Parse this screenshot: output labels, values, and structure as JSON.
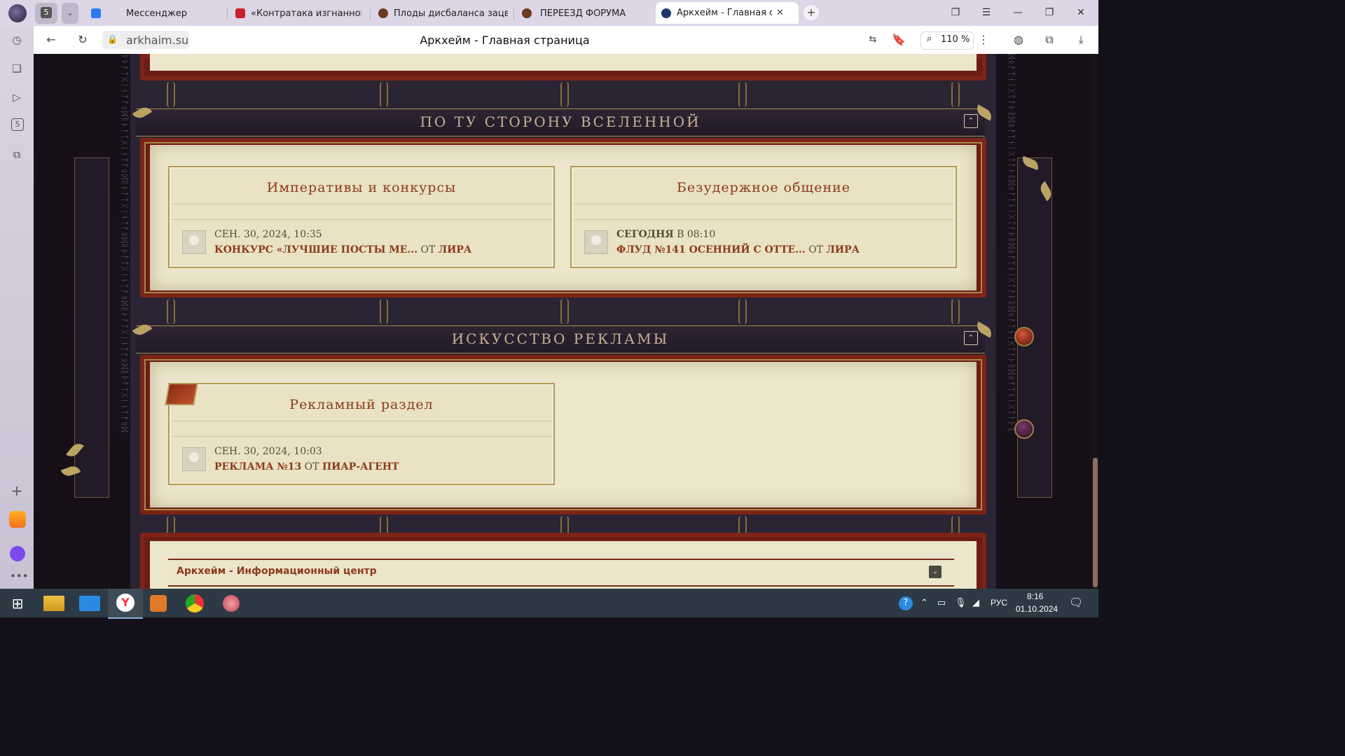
{
  "browser": {
    "tab_count": "5",
    "tabs": [
      {
        "label": "Мессенджер",
        "color": "#2a7cf6"
      },
      {
        "label": "«Контратака изгнанного",
        "color": "#c8202a"
      },
      {
        "label": "Плоды дисбаланса зацве",
        "color": "#6b3a22"
      },
      {
        "label": "ПЕРЕЕЗД ФОРУМА",
        "color": "#6b3a22"
      },
      {
        "label": "Аркхейм - Главная стр",
        "color": "#1f3a6a"
      }
    ],
    "url": "arkhaim.su",
    "page_title": "Аркхейм - Главная страница",
    "zoom": "110 %",
    "sidebar_badge": "5"
  },
  "forum": {
    "categories": [
      {
        "title": "ПО ТУ СТОРОНУ ВСЕЛЕННОЙ",
        "forums": [
          {
            "title": "Императивы и конкурсы",
            "date": "СЕН. 30, 2024, 10:35",
            "topic": "КОНКУРС «ЛУЧШИЕ ПОСТЫ МЕ...",
            "by": "ОТ",
            "author": "ЛИРА"
          },
          {
            "title": "Безудержное общение",
            "date_bold": "СЕГОДНЯ",
            "date": "В 08:10",
            "topic": "ФЛУД №141 ОСЕННИЙ С ОТТЕ...",
            "by": "ОТ",
            "author": "ЛИРА"
          }
        ]
      },
      {
        "title": "ИСКУССТВО РЕКЛАМЫ",
        "forums": [
          {
            "title": "Рекламный раздел",
            "date": "СЕН. 30, 2024, 10:03",
            "topic": "РЕКЛАМА №13",
            "by": "ОТ",
            "author": "ПИАР-АГЕНТ"
          }
        ]
      }
    ],
    "info_center": "Аркхейм - Информационный центр"
  },
  "taskbar": {
    "lang": "РУС",
    "time": "8:16",
    "date": "01.10.2024"
  },
  "colors": {
    "title_red": "#8c3a1c",
    "frame_red": "#6b1c14",
    "parchment": "#ebe6cc",
    "gold": "#a8894a"
  }
}
